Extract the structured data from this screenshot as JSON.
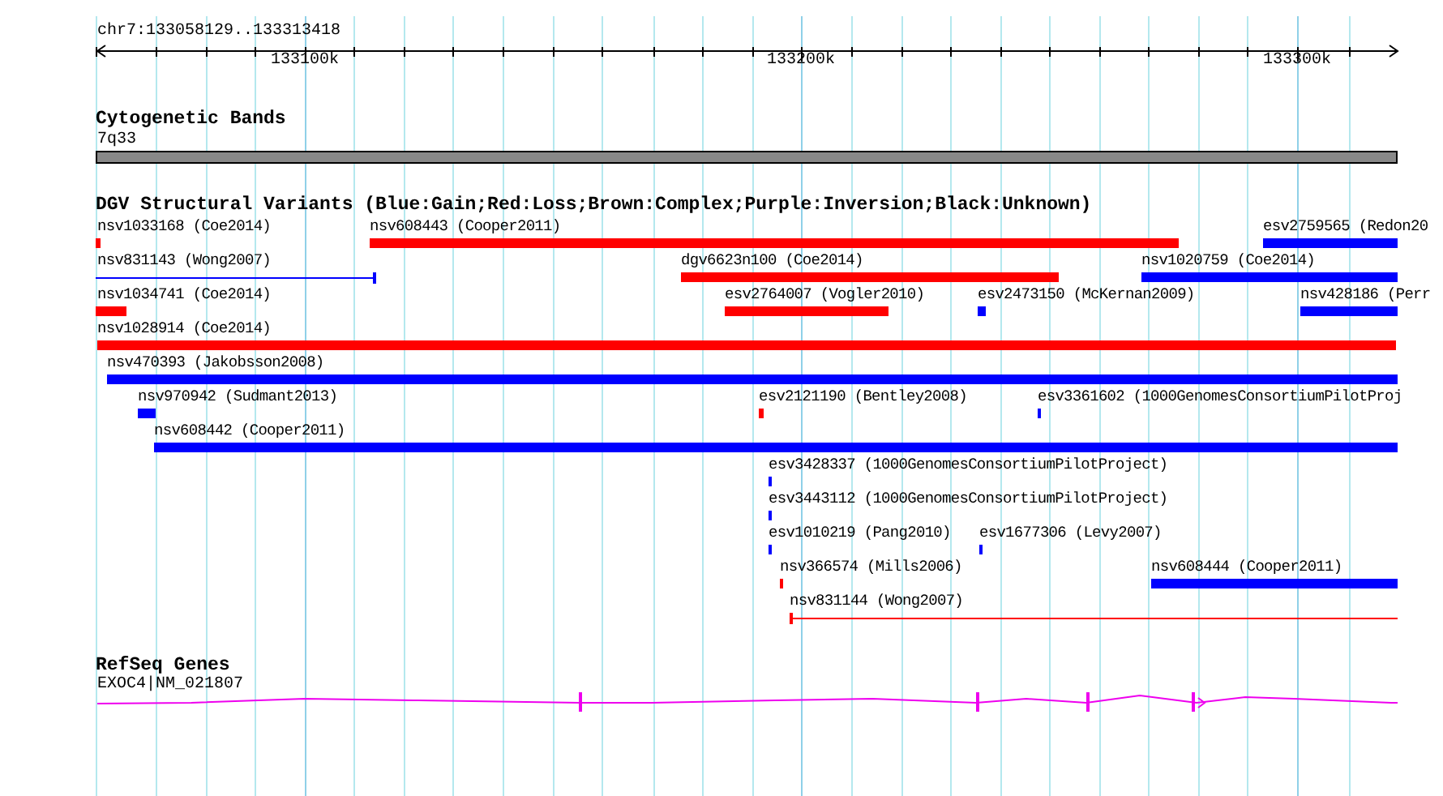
{
  "ruler": {
    "range": "chr7:133058129..133313418",
    "ticks": [
      "133100k",
      "133200k",
      "133300k"
    ]
  },
  "tracks": [
    {
      "kind": "bands",
      "title": "Cytogenetic Bands",
      "bands": [
        {
          "label": "7q33"
        }
      ]
    },
    {
      "kind": "variants",
      "title": "DGV Structural Variants (Blue:Gain;Red:Loss;Brown:Complex;Purple:Inversion;Black:Unknown)",
      "features": [
        {
          "label": "nsv1033168 (Coe2014)",
          "color": "#ff0000",
          "kind": "bar"
        },
        {
          "label": "nsv608443 (Cooper2011)",
          "color": "#ff0000",
          "kind": "bar"
        },
        {
          "label": "esv2759565 (Redon20",
          "color": "#0000ff",
          "kind": "bar"
        },
        {
          "label": "nsv831143 (Wong2007)",
          "color": "#0000ff",
          "kind": "line"
        },
        {
          "label": "dgv6623n100 (Coe2014)",
          "color": "#ff0000",
          "kind": "bar"
        },
        {
          "label": "nsv1020759 (Coe2014)",
          "color": "#0000ff",
          "kind": "bar"
        },
        {
          "label": "nsv1034741 (Coe2014)",
          "color": "#ff0000",
          "kind": "bar"
        },
        {
          "label": "esv2764007 (Vogler2010)",
          "color": "#ff0000",
          "kind": "bar"
        },
        {
          "label": "esv2473150 (McKernan2009)",
          "color": "#0000ff",
          "kind": "bar"
        },
        {
          "label": "nsv428186 (Perr",
          "color": "#0000ff",
          "kind": "bar"
        },
        {
          "label": "nsv1028914 (Coe2014)",
          "color": "#ff0000",
          "kind": "bar"
        },
        {
          "label": "nsv470393 (Jakobsson2008)",
          "color": "#0000ff",
          "kind": "bar"
        },
        {
          "label": "nsv970942 (Sudmant2013)",
          "color": "#0000ff",
          "kind": "bar"
        },
        {
          "label": "esv2121190 (Bentley2008)",
          "color": "#ff0000",
          "kind": "bar"
        },
        {
          "label": "esv3361602 (1000GenomesConsortiumPilotProj",
          "color": "#0000ff",
          "kind": "bar"
        },
        {
          "label": "nsv608442 (Cooper2011)",
          "color": "#0000ff",
          "kind": "bar"
        },
        {
          "label": "esv3428337 (1000GenomesConsortiumPilotProject)",
          "color": "#0000ff",
          "kind": "bar"
        },
        {
          "label": "esv3443112 (1000GenomesConsortiumPilotProject)",
          "color": "#0000ff",
          "kind": "bar"
        },
        {
          "label": "esv1010219 (Pang2010)",
          "color": "#0000ff",
          "kind": "bar"
        },
        {
          "label": "esv1677306 (Levy2007)",
          "color": "#0000ff",
          "kind": "bar"
        },
        {
          "label": "nsv366574 (Mills2006)",
          "color": "#ff0000",
          "kind": "bar"
        },
        {
          "label": "nsv608444 (Cooper2011)",
          "color": "#0000ff",
          "kind": "bar"
        },
        {
          "label": "nsv831144 (Wong2007)",
          "color": "#ff0000",
          "kind": "line"
        }
      ]
    },
    {
      "kind": "genes",
      "title": "RefSeq Genes",
      "genes": [
        {
          "label": "EXOC4|NM_021807"
        }
      ]
    }
  ]
}
